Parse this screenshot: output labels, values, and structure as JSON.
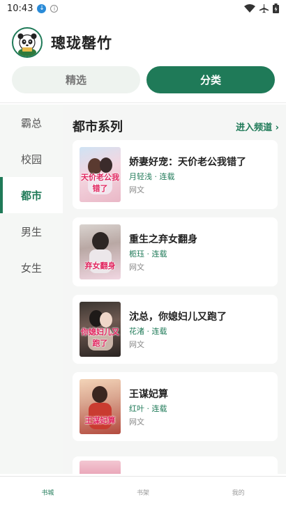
{
  "status": {
    "time": "10:43",
    "download_icon": "download-icon",
    "info_icon": "info-icon"
  },
  "header": {
    "title": "璁珑罄竹",
    "logo_icon": "panda-icon"
  },
  "top_tabs": [
    {
      "label": "精选",
      "active": false
    },
    {
      "label": "分类",
      "active": true
    }
  ],
  "sidebar": {
    "items": [
      {
        "label": "霸总"
      },
      {
        "label": "校园"
      },
      {
        "label": "都市"
      },
      {
        "label": "男生"
      },
      {
        "label": "女生"
      }
    ],
    "active_index": 2
  },
  "section": {
    "title": "都市系列",
    "link": "进入频道 ›"
  },
  "books": [
    {
      "title": "娇妻好宠：天价老公我错了",
      "meta": "月轻浅 · 连载",
      "tag": "网文",
      "cover_text": "天价老公我错了"
    },
    {
      "title": "重生之弃女翻身",
      "meta": "栀珏 · 连载",
      "tag": "网文",
      "cover_text": "弃女翻身"
    },
    {
      "title": "沈总，你媳妇儿又跑了",
      "meta": "花渚 · 连载",
      "tag": "网文",
      "cover_text": "你媳妇儿又跑了"
    },
    {
      "title": "王谋妃算",
      "meta": "红叶 · 连载",
      "tag": "网文",
      "cover_text": "王谋妃算"
    }
  ],
  "bottom_nav": [
    {
      "label": "书城",
      "active": true
    },
    {
      "label": "书架",
      "active": false
    },
    {
      "label": "我的",
      "active": false
    }
  ],
  "colors": {
    "accent": "#1f7a58",
    "sidebar_bg": "#f5f7f5",
    "tab_inactive_bg": "#eef3ef"
  }
}
